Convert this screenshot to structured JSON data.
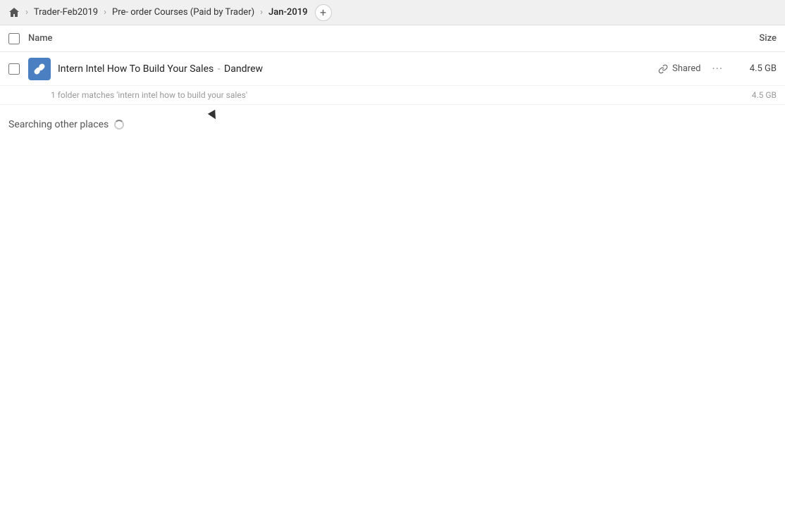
{
  "breadcrumb": {
    "home_icon": "home",
    "items": [
      {
        "label": "Trader-Feb2019",
        "current": false
      },
      {
        "label": "Pre- order Courses (Paid by Trader)",
        "current": false
      },
      {
        "label": "Jan-2019",
        "current": true
      }
    ],
    "add_label": "+"
  },
  "column_header": {
    "name_label": "Name",
    "size_label": "Size"
  },
  "file": {
    "name_main": "Intern Intel How To Build Your Sales",
    "name_separator": " - ",
    "name_sub": "Dandrew",
    "shared_label": "Shared",
    "more_label": "···",
    "size": "4.5 GB"
  },
  "match_info": {
    "text": "1 folder matches 'intern intel how to build your sales'",
    "size": "4.5 GB"
  },
  "searching": {
    "label": "Searching other places"
  }
}
